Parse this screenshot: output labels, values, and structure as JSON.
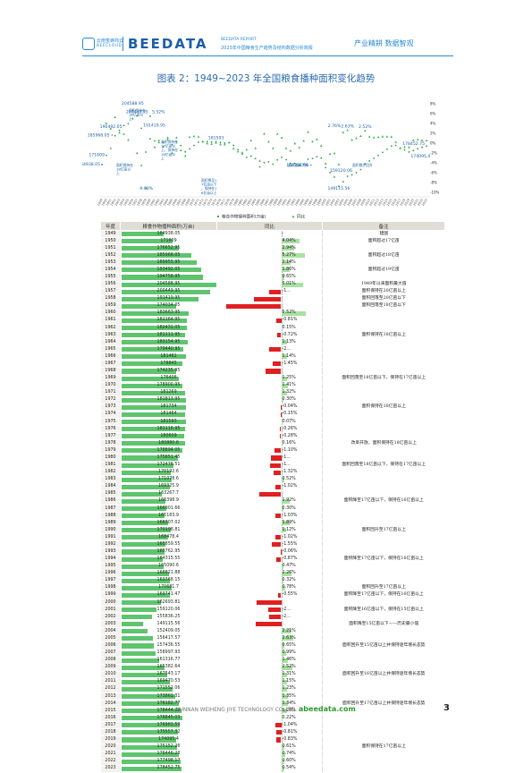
{
  "header": {
    "logo_cn": "云南蜜蜂商云",
    "logo_en": "BEECLOUD",
    "brand": "BEEDATA",
    "report_label": "BEEDATA REPORT",
    "report_title": "2023年中国粮食生产趋势及结构数据分析简报",
    "slogan": "产业精耕 数据智观",
    "accent_color": "#2a8ad6"
  },
  "figure_title": "图表 2：1949~2023 年全国粮食播种面积变化趋势",
  "chart_data": {
    "type": "line",
    "x": [
      1949,
      1950,
      1951,
      1952,
      1953,
      1954,
      1955,
      1956,
      1957,
      1958,
      1959,
      1960,
      1961,
      1962,
      1963,
      1964,
      1965,
      1966,
      1967,
      1968,
      1969,
      1970,
      1971,
      1972,
      1973,
      1974,
      1975,
      1976,
      1977,
      1978,
      1979,
      1980,
      1981,
      1982,
      1983,
      1984,
      1985,
      1986,
      1987,
      1988,
      1989,
      1990,
      1991,
      1992,
      1993,
      1994,
      1995,
      1996,
      1997,
      1998,
      1999,
      2000,
      2001,
      2002,
      2003,
      2004,
      2005,
      2006,
      2007,
      2008,
      2009,
      2010,
      2011,
      2012,
      2013,
      2014,
      2015,
      2016,
      2017,
      2018,
      2019,
      2020,
      2021,
      2022,
      2023
    ],
    "series": [
      {
        "name": "粮食作物播种面积(万亩)",
        "axis": "left",
        "marker": "dot"
      },
      {
        "name": "同比",
        "axis": "right",
        "marker": "triangle"
      }
    ],
    "right_axis_ticks": [
      "8%",
      "6%",
      "4%",
      "2%",
      "0%",
      "-2%",
      "-4%",
      "-6%",
      "-8%",
      "-10%"
    ],
    "legend_position": "bottom",
    "point_labels": [
      "164938.05",
      "171609",
      "185968.05 •",
      "190492.05",
      "200449.95",
      "204588.95",
      "191419.95",
      "5.52%",
      "-9.08%",
      "181593",
      "164315.56 •",
      "2.76%",
      "159120.06",
      "149115.56",
      "2.63%",
      "2.52%",
      "178452.75",
      "174095.4"
    ],
    "annotations": [
      "面积保持在18亿亩以上",
      "面积保持在18亿亩以上",
      "面积保持在17亿亩以上，保持在16亿亩以上",
      "面积降至17亿亩以下，保持在16亿亩以上",
      "面积逐年下降",
      "面积稳步回升"
    ]
  },
  "table": {
    "headers": [
      "年度",
      "粮食作物播种面积(万亩)",
      "同比",
      "备注"
    ],
    "max_area": 204588.95,
    "max_pct": 9.08,
    "rows": [
      {
        "year": "1949",
        "area": "164938.05",
        "yoy": "-",
        "pct": 0,
        "note": "建国"
      },
      {
        "year": "1950",
        "area": "171609",
        "yoy": "4.04%",
        "pct": 4.04,
        "note": "面积超过17亿亩"
      },
      {
        "year": "1951",
        "area": "176652.95",
        "yoy": "2.94%",
        "pct": 2.94,
        "note": ""
      },
      {
        "year": "1952",
        "area": "185968.05",
        "yoy": "5.27%",
        "pct": 5.27,
        "note": "面积超过18亿亩"
      },
      {
        "year": "1953",
        "area": "189955.95",
        "yoy": "2.14%",
        "pct": 2.14,
        "note": ""
      },
      {
        "year": "1954",
        "area": "193492.05",
        "yoy": "1.86%",
        "pct": 1.86,
        "note": "面积超过19亿亩"
      },
      {
        "year": "1955",
        "area": "194758.95",
        "yoy": "0.65%",
        "pct": 0.65,
        "note": ""
      },
      {
        "year": "1956",
        "area": "204588.95",
        "yoy": "5.01%",
        "pct": 5.01,
        "note": "1949年以来面积最大值"
      },
      {
        "year": "1957",
        "area": "200449.95",
        "yoy": "-1...",
        "pct": -2.02,
        "note": "面积保持在20亿亩以上"
      },
      {
        "year": "1958",
        "area": "191419.95",
        "yoy": "",
        "pct": -4.5,
        "note": "面积回落至20亿亩以下"
      },
      {
        "year": "1959",
        "area": "174034.05",
        "yoy": "",
        "pct": -9.08,
        "note": "面积回落至18亿亩以下"
      },
      {
        "year": "1960",
        "area": "183663.95",
        "yoy": "5.52%",
        "pct": 5.52,
        "note": ""
      },
      {
        "year": "1961",
        "area": "182164.95",
        "yoy": "-0.81%",
        "pct": -0.81,
        "note": ""
      },
      {
        "year": "1962",
        "area": "182431.05",
        "yoy": "0.15%",
        "pct": 0.15,
        "note": ""
      },
      {
        "year": "1963",
        "area": "181111.95",
        "yoy": "-0.72%",
        "pct": -0.72,
        "note": "面积保持在18亿亩以上"
      },
      {
        "year": "1964",
        "area": "183154.95",
        "yoy": "1.13%",
        "pct": 1.13,
        "note": ""
      },
      {
        "year": "1965",
        "area": "179440.95",
        "yoy": "-2...",
        "pct": -2.03,
        "note": ""
      },
      {
        "year": "1966",
        "area": "181482",
        "yoy": "1.14%",
        "pct": 1.14,
        "note": ""
      },
      {
        "year": "1967",
        "area": "178845",
        "yoy": "-1.45%",
        "pct": -1.45,
        "note": ""
      },
      {
        "year": "1968",
        "area": "174235.95",
        "yoy": "",
        "pct": -2.58,
        "note": ""
      },
      {
        "year": "1969",
        "area": "176406",
        "yoy": "1.25%",
        "pct": 1.25,
        "note": "面积回落至18亿亩以下，保持在17亿亩以上"
      },
      {
        "year": "1970",
        "area": "178900.95",
        "yoy": "1.41%",
        "pct": 1.41,
        "note": ""
      },
      {
        "year": "1971",
        "area": "181269",
        "yoy": "1.32%",
        "pct": 1.32,
        "note": ""
      },
      {
        "year": "1972",
        "area": "181813.95",
        "yoy": "0.30%",
        "pct": 0.3,
        "note": ""
      },
      {
        "year": "1973",
        "area": "181734",
        "yoy": "-0.04%",
        "pct": -0.04,
        "note": "面积保持在18亿亩以上"
      },
      {
        "year": "1974",
        "area": "181464",
        "yoy": "-0.15%",
        "pct": -0.15,
        "note": ""
      },
      {
        "year": "1975",
        "area": "181593",
        "yoy": "0.07%",
        "pct": 0.07,
        "note": ""
      },
      {
        "year": "1976",
        "area": "181116.95",
        "yoy": "-0.26%",
        "pct": -0.26,
        "note": ""
      },
      {
        "year": "1977",
        "area": "180609",
        "yoy": "-0.28%",
        "pct": -0.28,
        "note": ""
      },
      {
        "year": "1978",
        "area": "180880.8",
        "yoy": "0.16%",
        "pct": 0.16,
        "note": "改革开放，面积保持在18亿亩以上"
      },
      {
        "year": "1979",
        "area": "178894.05",
        "yoy": "-1.10%",
        "pct": -1.1,
        "note": ""
      },
      {
        "year": "1980",
        "area": "175851.45",
        "yoy": "-1...",
        "pct": -1.7,
        "note": ""
      },
      {
        "year": "1981",
        "area": "172476.51",
        "yoy": "-1...",
        "pct": -1.92,
        "note": "面积回落至18亿亩以下，保持在17亿亩以上"
      },
      {
        "year": "1982",
        "area": "170192.6",
        "yoy": "-1.32%",
        "pct": -1.32,
        "note": ""
      },
      {
        "year": "1983",
        "area": "171078.6",
        "yoy": "0.52%",
        "pct": 0.52,
        "note": ""
      },
      {
        "year": "1984",
        "area": "169325.9",
        "yoy": "-1.02%",
        "pct": -1.02,
        "note": ""
      },
      {
        "year": "1985",
        "area": "163267.7",
        "yoy": "",
        "pct": -3.58,
        "note": ""
      },
      {
        "year": "1986",
        "area": "166398.9",
        "yoy": "1.92%",
        "pct": 1.92,
        "note": "面积降至17亿亩以下，保持在16亿亩以上"
      },
      {
        "year": "1987",
        "area": "166901.66",
        "yoy": "0.30%",
        "pct": 0.3,
        "note": ""
      },
      {
        "year": "1988",
        "area": "165183.9",
        "yoy": "-1.03%",
        "pct": -1.03,
        "note": ""
      },
      {
        "year": "1989",
        "area": "168307.02",
        "yoy": "1.89%",
        "pct": 1.89,
        "note": ""
      },
      {
        "year": "1990",
        "area": "170198.81",
        "yoy": "1.12%",
        "pct": 1.12,
        "note": "面积回升至17亿亩以上"
      },
      {
        "year": "1991",
        "area": "168478.4",
        "yoy": "-1.02%",
        "pct": -1.02,
        "note": ""
      },
      {
        "year": "1992",
        "area": "165859.55",
        "yoy": "-1.55%",
        "pct": -1.55,
        "note": ""
      },
      {
        "year": "1993",
        "area": "165762.95",
        "yoy": "-0.06%",
        "pct": -0.06,
        "note": ""
      },
      {
        "year": "1994",
        "area": "164315.55",
        "yoy": "-0.87%",
        "pct": -0.87,
        "note": "面积降至17亿亩以下，保持在16亿亩以上"
      },
      {
        "year": "1995",
        "area": "165090.6",
        "yoy": "0.47%",
        "pct": 0.47,
        "note": ""
      },
      {
        "year": "1996",
        "area": "168821.88",
        "yoy": "2.26%",
        "pct": 2.26,
        "note": ""
      },
      {
        "year": "1997",
        "area": "169368.15",
        "yoy": "0.32%",
        "pct": 0.32,
        "note": ""
      },
      {
        "year": "1998",
        "area": "170681.7",
        "yoy": "0.78%",
        "pct": 0.78,
        "note": "面积回升至17亿亩以上"
      },
      {
        "year": "1999",
        "area": "169741.47",
        "yoy": "-0.55%",
        "pct": -0.55,
        "note": "面积降至17亿亩以下，保持在16亿亩以上"
      },
      {
        "year": "2000",
        "area": "162693.81",
        "yoy": "",
        "pct": -4.15,
        "note": ""
      },
      {
        "year": "2001",
        "area": "159120.06",
        "yoy": "-2...",
        "pct": -2.2,
        "note": "面积降至16亿亩以下，保持在15亿亩以上"
      },
      {
        "year": "2002",
        "area": "155836.25",
        "yoy": "-2...",
        "pct": -2.06,
        "note": ""
      },
      {
        "year": "2003",
        "area": "149115.56",
        "yoy": "",
        "pct": -4.31,
        "note": "面积降至15亿亩以下——历史最小值"
      },
      {
        "year": "2004",
        "area": "152409.05",
        "yoy": "2.21%",
        "pct": 2.21,
        "note": ""
      },
      {
        "year": "2005",
        "area": "156417.57",
        "yoy": "2.63%",
        "pct": 2.63,
        "note": ""
      },
      {
        "year": "2006",
        "area": "157436.55",
        "yoy": "0.65%",
        "pct": 0.65,
        "note": "面积回升至15亿亩以上并保持逐年增长态势"
      },
      {
        "year": "2007",
        "area": "158997.93",
        "yoy": "0.99%",
        "pct": 0.99,
        "note": ""
      },
      {
        "year": "2008",
        "area": "161316.77",
        "yoy": "1.46%",
        "pct": 1.46,
        "note": ""
      },
      {
        "year": "2009",
        "area": "165382.64",
        "yoy": "2.52%",
        "pct": 2.52,
        "note": ""
      },
      {
        "year": "2010",
        "area": "167543.17",
        "yoy": "1.31%",
        "pct": 1.31,
        "note": "面积回升至16亿亩以上并保持逐年增长态势"
      },
      {
        "year": "2011",
        "area": "169470.53",
        "yoy": "1.15%",
        "pct": 1.15,
        "note": ""
      },
      {
        "year": "2012",
        "area": "171552.06",
        "yoy": "1.23%",
        "pct": 1.23,
        "note": ""
      },
      {
        "year": "2013",
        "area": "173861.31",
        "yoy": "1.35%",
        "pct": 1.35,
        "note": ""
      },
      {
        "year": "2014",
        "area": "176182.77",
        "yoy": "1.34%",
        "pct": 1.34,
        "note": "面积回升至17亿亩以上并保持逐年增长态势"
      },
      {
        "year": "2015",
        "area": "178444.22",
        "yoy": "1.28%",
        "pct": 1.28,
        "note": ""
      },
      {
        "year": "2016",
        "area": "178845.03",
        "yoy": "0.22%",
        "pct": 0.22,
        "note": ""
      },
      {
        "year": "2017",
        "area": "176983.59",
        "yoy": "-1.04%",
        "pct": -1.04,
        "note": ""
      },
      {
        "year": "2018",
        "area": "175557.32",
        "yoy": "-0.81%",
        "pct": -0.81,
        "note": ""
      },
      {
        "year": "2019",
        "area": "174095.4",
        "yoy": "-0.83%",
        "pct": -0.83,
        "note": ""
      },
      {
        "year": "2020",
        "area": "175152.26",
        "yoy": "0.61%",
        "pct": 0.61,
        "note": "面积保持在17亿亩以上"
      },
      {
        "year": "2021",
        "area": "176446.23",
        "yoy": "0.74%",
        "pct": 0.74,
        "note": ""
      },
      {
        "year": "2022",
        "area": "177498.17",
        "yoy": "0.60%",
        "pct": 0.6,
        "note": ""
      },
      {
        "year": "2023",
        "area": "178452.75",
        "yoy": "0.54%",
        "pct": 0.54,
        "note": ""
      }
    ]
  },
  "footer": {
    "company": "YUNNAN WEIHENG JIYE TECHNOLOGY CO.,LTD.",
    "site": "abeedata.com",
    "page_number": "3"
  }
}
